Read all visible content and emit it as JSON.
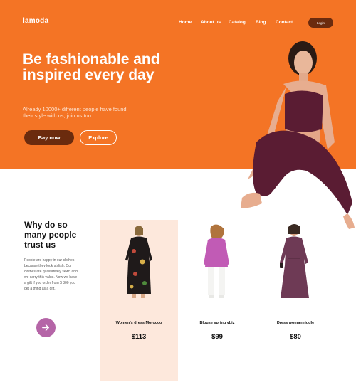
{
  "brand": {
    "logo": "lamoda"
  },
  "nav": {
    "items": [
      {
        "label": "Home"
      },
      {
        "label": "About us"
      },
      {
        "label": "Catalog"
      },
      {
        "label": "Blog"
      },
      {
        "label": "Contact"
      }
    ],
    "login_label": "Login"
  },
  "hero": {
    "title": "Be fashionable and inspired every day",
    "subtitle": "Already 10000+ different people have found their style with us, join us too",
    "buy_label": "Bay now",
    "explore_label": "Explore",
    "colors": {
      "background": "#f47425",
      "dark_button": "#6b2b0e"
    }
  },
  "why": {
    "title": "Why do so many people trust us",
    "text": "People are happy in our clothes because they look stylish. Our clothes are qualitatively sewn and we carry this value. Now we have a gift if you order from $ 300 you get a thing as a gift.",
    "arrow_icon": "arrow-right-icon",
    "accent": "#b565a7"
  },
  "products": [
    {
      "name": "Women's dress Morocco",
      "price": "$113",
      "highlighted": true
    },
    {
      "name": "Blouse spring vbiz",
      "price": "$99",
      "highlighted": false
    },
    {
      "name": "Dress woman riddle",
      "price": "$80",
      "highlighted": false
    }
  ]
}
